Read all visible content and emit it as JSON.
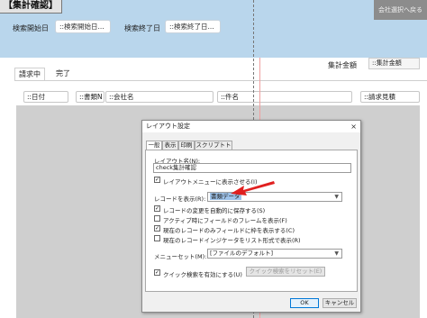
{
  "header": {
    "title": "【集計確認】",
    "top_right_button": "会社選択へ戻る",
    "search_start_label": "検索開始日",
    "search_start_value": "::検索開始日...",
    "search_end_label": "検索終了日",
    "search_end_value": "::検索終了日..."
  },
  "total": {
    "label": "集計金額",
    "value": "::集計金額"
  },
  "tabs": [
    {
      "label": "請求中"
    },
    {
      "label": "完了"
    }
  ],
  "list_columns": [
    {
      "label": "::日付"
    },
    {
      "label": "::書類N"
    },
    {
      "label": "::会社名"
    },
    {
      "label": "::件名"
    },
    {
      "label": "::請求見積"
    }
  ],
  "dialog": {
    "title": "レイアウト設定",
    "close_glyph": "×",
    "tabs": [
      {
        "label": "一般"
      },
      {
        "label": "表示"
      },
      {
        "label": "印刷"
      },
      {
        "label": "スクリプトトリガ"
      }
    ],
    "layout_name_label": "レイアウト名(N):",
    "layout_name_value": "check集計確認",
    "show_in_menu": "レイアウトメニューに表示させる(I)",
    "show_records_label": "レコードを表示(R):",
    "show_records_value": "書類データ",
    "options": [
      {
        "label": "レコードの変更を自動的に保存する(S)",
        "checked": true
      },
      {
        "label": "アクティブ時にフィールドのフレームを表示(F)",
        "checked": false
      },
      {
        "label": "現在のレコードのみフィールドに枠を表示する(C)",
        "checked": true
      },
      {
        "label": "現在のレコードインジケータをリスト形式で表示(R)",
        "checked": false
      }
    ],
    "menu_set_label": "メニューセット(M):",
    "menu_set_value": "[ファイルのデフォルト]",
    "quick_find": "クイック検索を有効にする(U)",
    "quick_find_reset": "クイック検索をリセット(E)",
    "ok": "OK",
    "cancel": "キャンセル"
  },
  "colors": {
    "header_bg": "#b9d6ec",
    "list_bg": "#cfcfcf",
    "arrow": "#e02020"
  },
  "icons": {
    "close": "close-icon",
    "arrow": "red-arrow-icon",
    "dropdown": "chevron-down-icon"
  }
}
